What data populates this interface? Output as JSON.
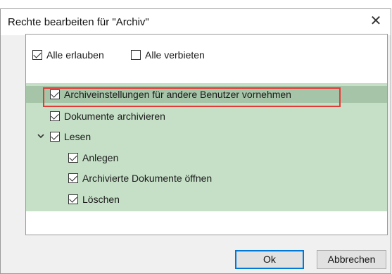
{
  "dialog": {
    "title": "Rechte bearbeiten für \"Archiv\"",
    "close_glyph": "✕"
  },
  "options": {
    "allow_all": {
      "label": "Alle erlauben",
      "checked": true
    },
    "deny_all": {
      "label": "Alle verbieten",
      "checked": false
    }
  },
  "tree": {
    "items": [
      {
        "label": "Archiveinstellungen für andere Benutzer vornehmen",
        "checked": true,
        "level": 0,
        "selected": true
      },
      {
        "label": "Dokumente archivieren",
        "checked": true,
        "level": 0
      },
      {
        "label": "Lesen",
        "checked": true,
        "level": 0,
        "expanded": true
      },
      {
        "label": "Anlegen",
        "checked": true,
        "level": 1
      },
      {
        "label": "Archivierte Dokumente öffnen",
        "checked": true,
        "level": 1
      },
      {
        "label": "Löschen",
        "checked": true,
        "level": 1
      }
    ]
  },
  "buttons": {
    "ok": "Ok",
    "cancel": "Abbrechen"
  },
  "colors": {
    "tree_bg": "#c6e0c7",
    "selected_row": "#a6c4a7",
    "highlight_border": "#e53935",
    "default_button_border": "#0078d7"
  }
}
